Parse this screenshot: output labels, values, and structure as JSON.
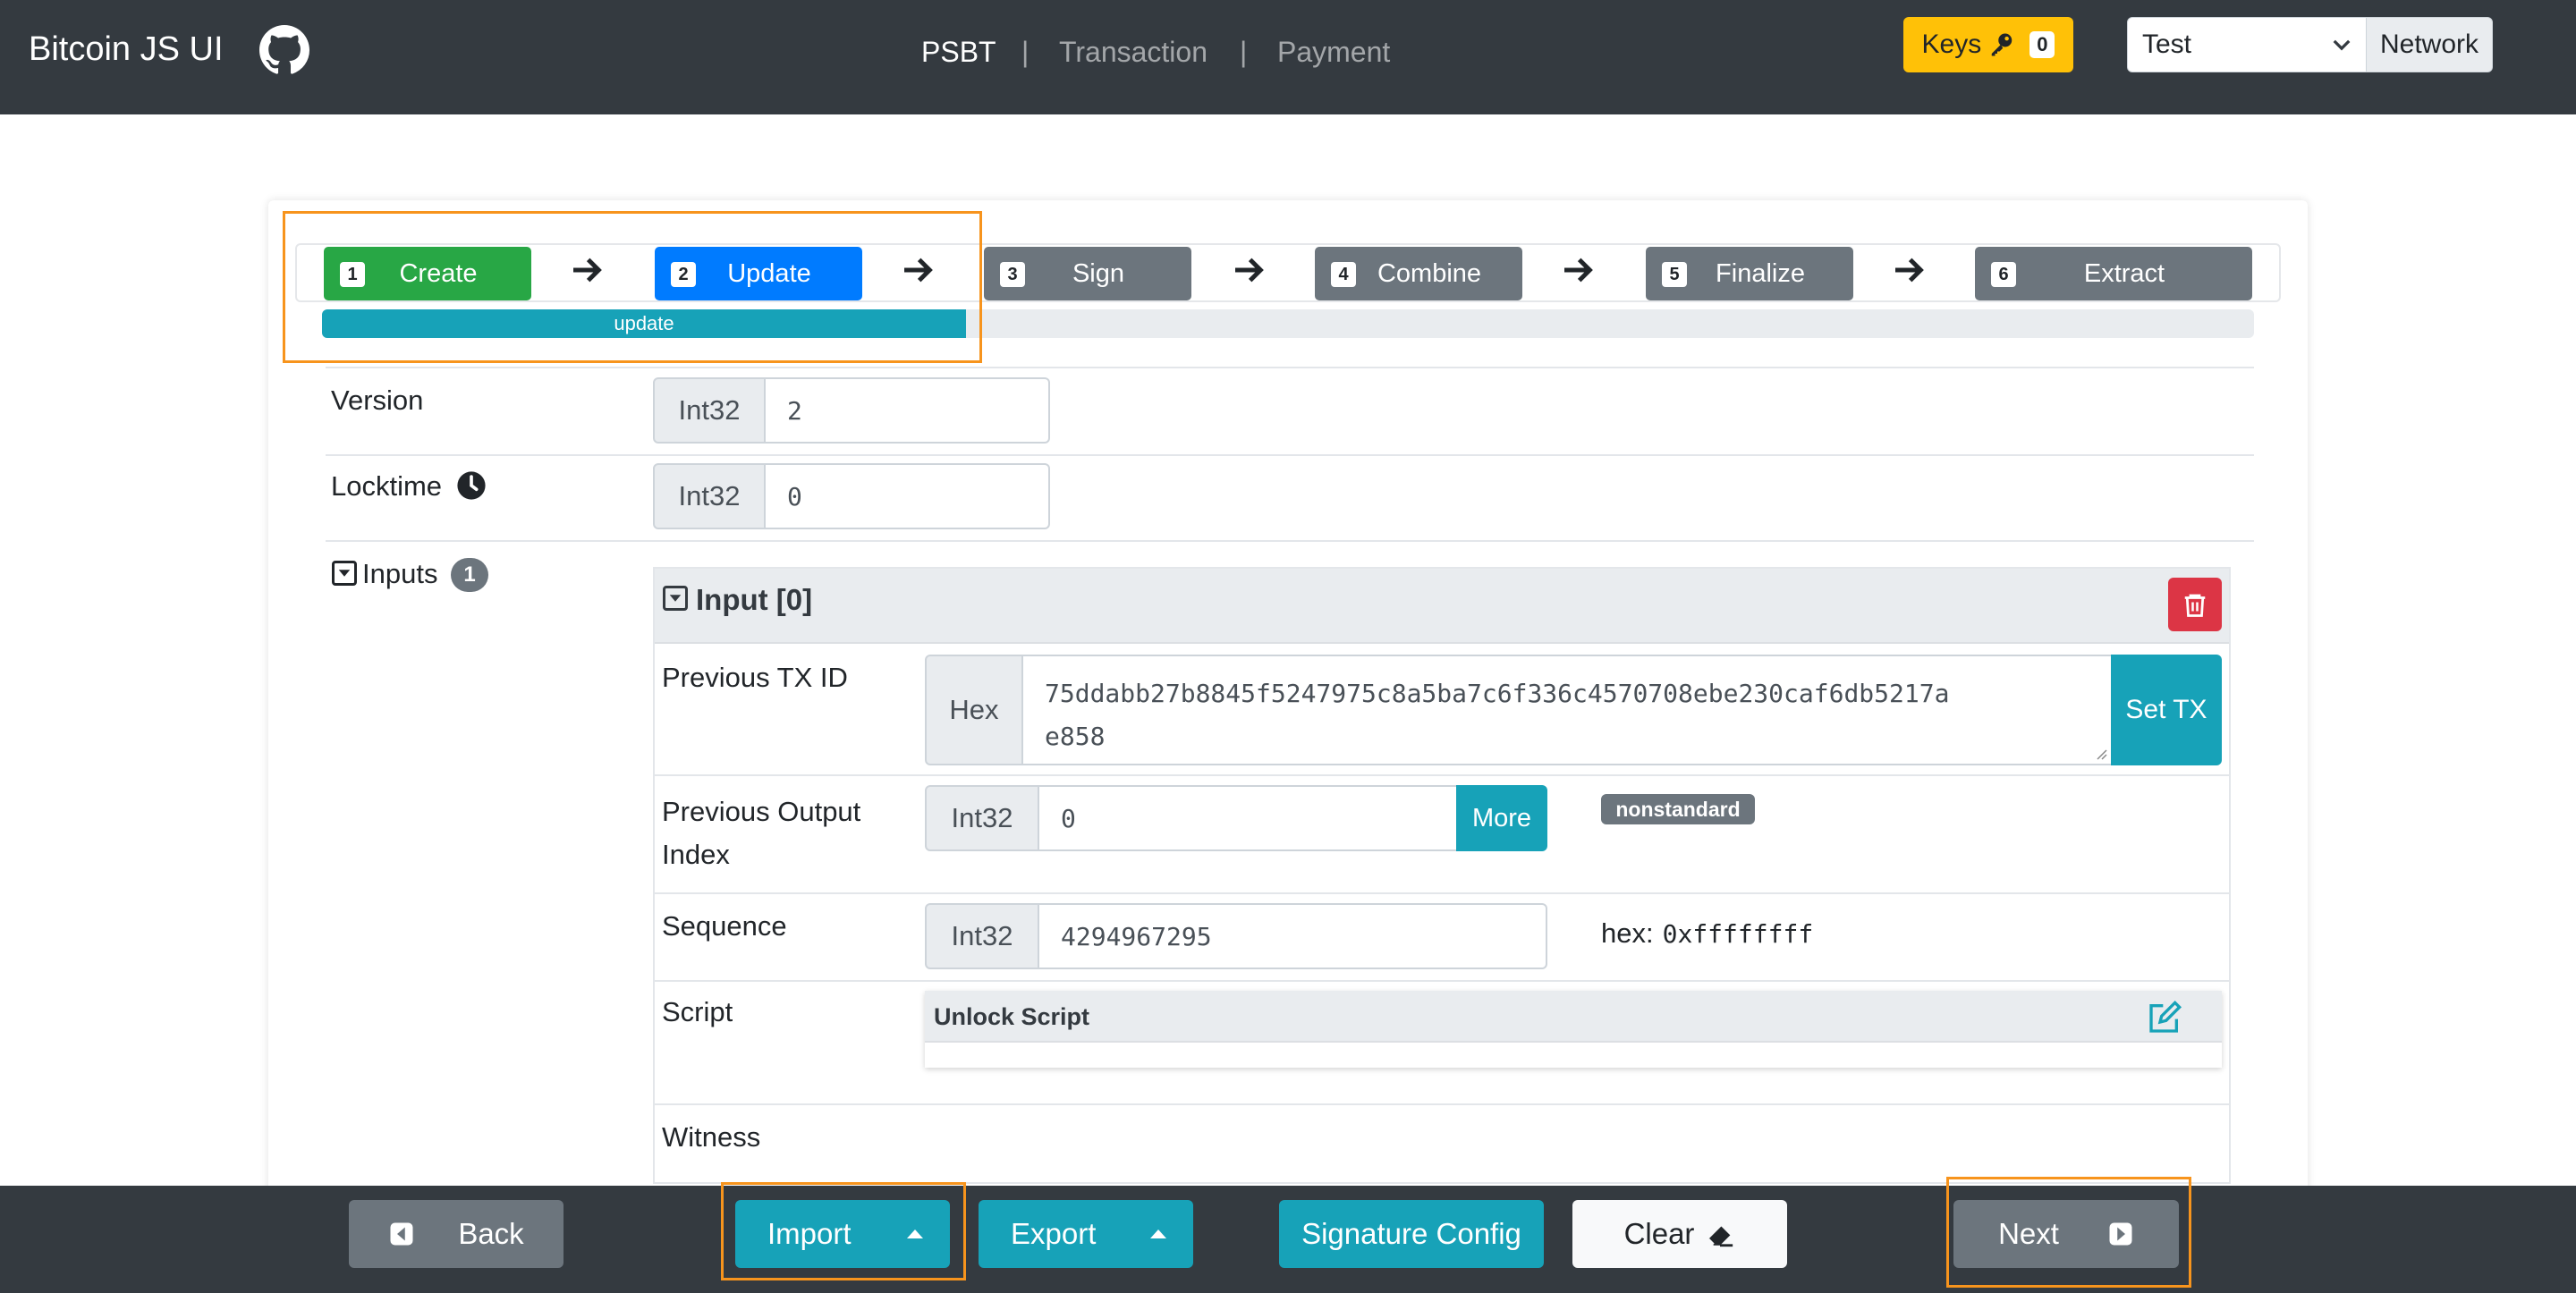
{
  "app": {
    "title": "Bitcoin JS UI"
  },
  "nav": {
    "psbt": "PSBT",
    "separator": "|",
    "transaction": "Transaction",
    "payment": "Payment"
  },
  "keys": {
    "label": "Keys",
    "count": "0"
  },
  "network": {
    "selected": "Test",
    "label": "Network"
  },
  "steps": [
    {
      "num": "1",
      "label": "Create",
      "color": "#28a745"
    },
    {
      "num": "2",
      "label": "Update",
      "color": "#007bff"
    },
    {
      "num": "3",
      "label": "Sign",
      "color": "#6c757d"
    },
    {
      "num": "4",
      "label": "Combine",
      "color": "#6c757d"
    },
    {
      "num": "5",
      "label": "Finalize",
      "color": "#6c757d"
    },
    {
      "num": "6",
      "label": "Extract",
      "color": "#6c757d"
    }
  ],
  "progress": {
    "label": "update",
    "fraction": 0.333
  },
  "version": {
    "label": "Version",
    "type": "Int32",
    "value": "2"
  },
  "locktime": {
    "label": "Locktime",
    "type": "Int32",
    "value": "0"
  },
  "inputs": {
    "label": "Inputs",
    "count": "1"
  },
  "input0": {
    "title": "Input [0]",
    "prev_txid": {
      "label": "Previous TX ID",
      "type": "Hex",
      "value_line1": "75ddabb27b8845f5247975c8a5ba7c6f336c4570708ebe230caf6db5217a",
      "value_line2": "e858",
      "set_btn": "Set TX"
    },
    "prev_index": {
      "label_line1": "Previous Output",
      "label_line2": "Index",
      "type": "Int32",
      "value": "0",
      "more_btn": "More",
      "badge": "nonstandard"
    },
    "sequence": {
      "label": "Sequence",
      "type": "Int32",
      "value": "4294967295",
      "hex_label": "hex:",
      "hex_value": "0xffffffff"
    },
    "script": {
      "label": "Script",
      "header": "Unlock Script"
    },
    "witness": {
      "label": "Witness"
    }
  },
  "footer": {
    "back": "Back",
    "import": "Import",
    "export": "Export",
    "sig_config": "Signature Config",
    "clear": "Clear",
    "next": "Next"
  },
  "colors": {
    "navbar": "#343a40",
    "warning": "#ffc107",
    "info": "#17a2b8",
    "danger": "#dc3545",
    "highlight": "#f7941d"
  }
}
